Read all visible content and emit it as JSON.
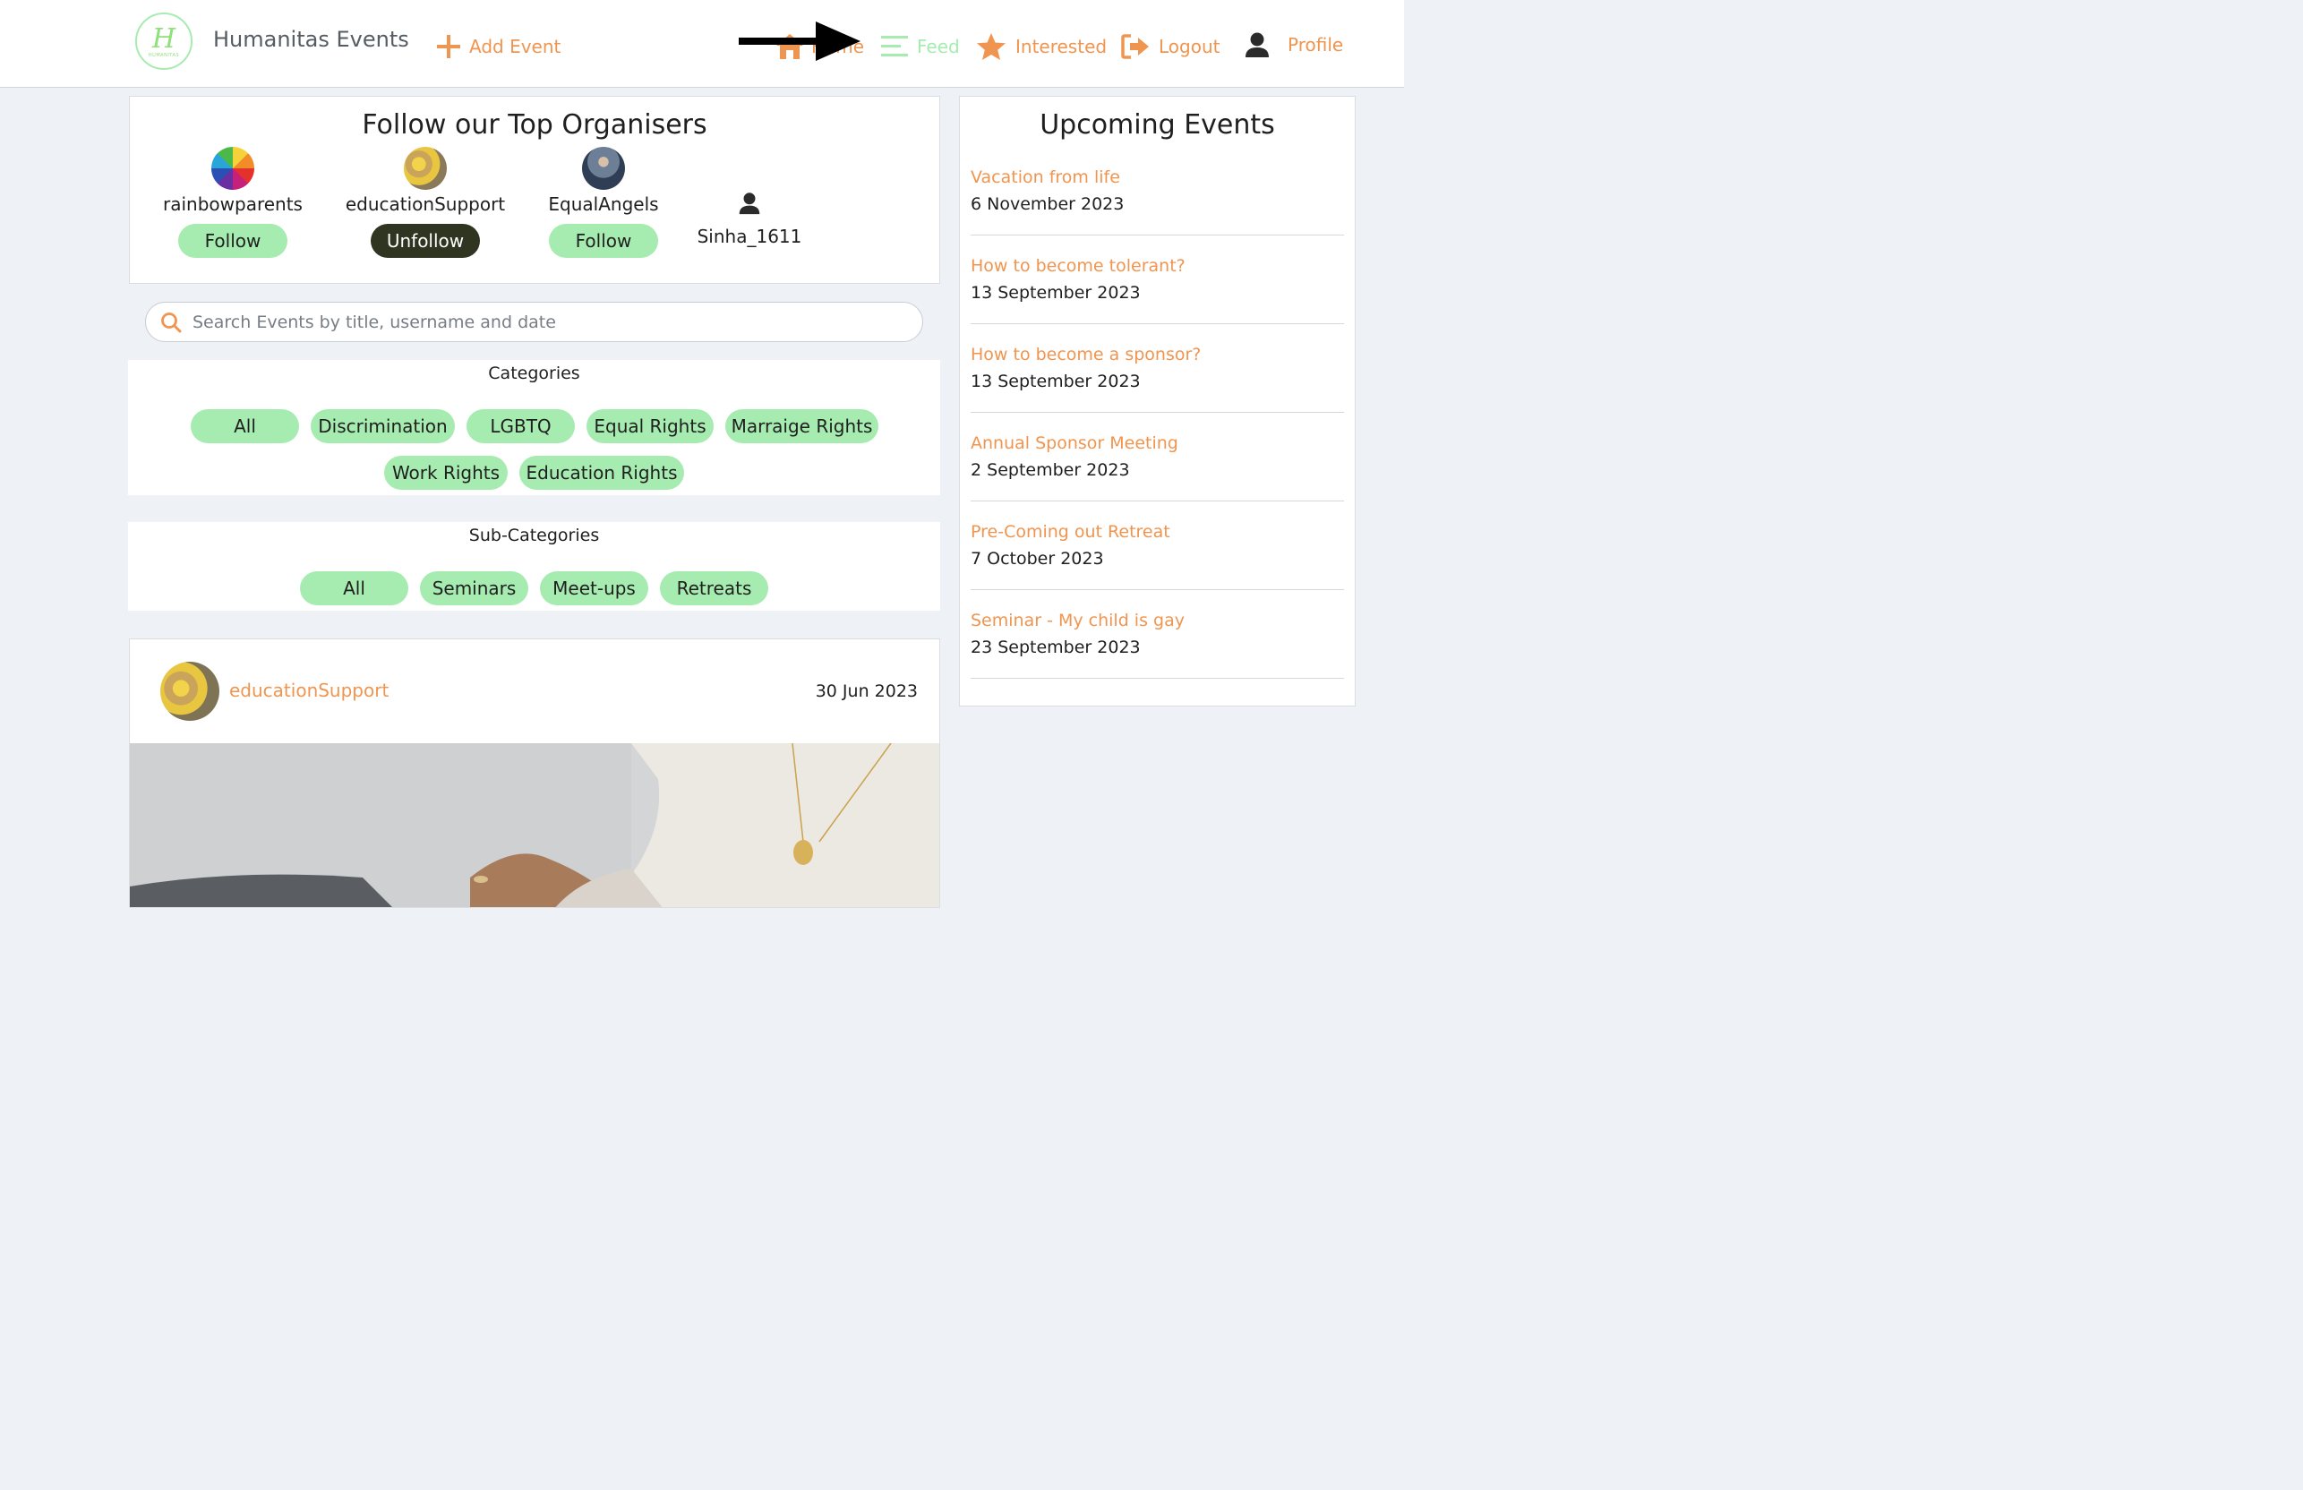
{
  "brand": {
    "name": "Humanitas Events",
    "logo_letter": "H",
    "logo_small": "HUMANITAS"
  },
  "nav": {
    "add_event": "Add Event",
    "home": "Home",
    "feed": "Feed",
    "interested": "Interested",
    "logout": "Logout",
    "profile": "Profile"
  },
  "colors": {
    "accent": "#f0954f",
    "chip": "#a6ecb0",
    "dark_button": "#2f3520",
    "page_bg": "#eef2f6"
  },
  "organisers": {
    "title": "Follow our Top Organisers",
    "items": [
      {
        "name": "rainbowparents",
        "button": "Follow",
        "following": false,
        "avatar": "rainbow-avatar"
      },
      {
        "name": "educationSupport",
        "button": "Unfollow",
        "following": true,
        "avatar": "photo-avatar"
      },
      {
        "name": "EqualAngels",
        "button": "Follow",
        "following": false,
        "avatar": "photo-avatar"
      },
      {
        "name": "Sinha_1611",
        "button": "",
        "following": false,
        "avatar": "user-icon"
      }
    ]
  },
  "search": {
    "placeholder": "Search Events by title, username and date",
    "value": ""
  },
  "categories": {
    "title": "Categories",
    "items": [
      "All",
      "Discrimination",
      "LGBTQ",
      "Equal Rights",
      "Marraige Rights",
      "Work Rights",
      "Education Rights"
    ]
  },
  "subcategories": {
    "title": "Sub-Categories",
    "items": [
      "All",
      "Seminars",
      "Meet-ups",
      "Retreats"
    ]
  },
  "post": {
    "user": "educationSupport",
    "date": "30 Jun 2023"
  },
  "upcoming": {
    "title": "Upcoming Events",
    "events": [
      {
        "title": "Vacation from life",
        "date": "6 November 2023"
      },
      {
        "title": "How to become tolerant?",
        "date": "13 September 2023"
      },
      {
        "title": "How to become a sponsor?",
        "date": "13 September 2023"
      },
      {
        "title": "Annual Sponsor Meeting",
        "date": "2 September 2023"
      },
      {
        "title": "Pre-Coming out Retreat",
        "date": "7 October 2023"
      },
      {
        "title": "Seminar - My child is gay",
        "date": "23 September 2023"
      }
    ]
  }
}
